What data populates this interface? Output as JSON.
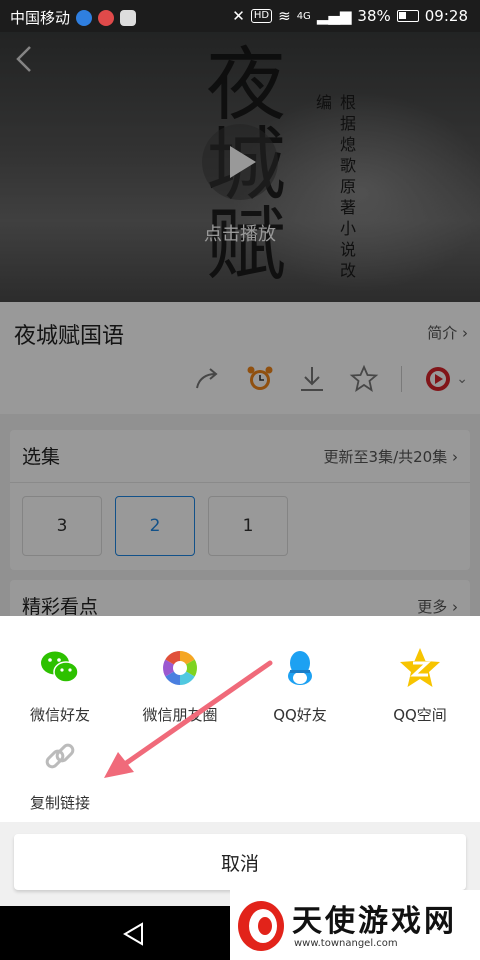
{
  "status_bar": {
    "carrier": "中国移动",
    "battery": "38%",
    "time": "09:28",
    "network": "4G",
    "hd": "HD"
  },
  "video": {
    "play_label": "点击播放",
    "poster_title": "夜城赋",
    "poster_subtitle": "根据熄歌原著小说改编"
  },
  "show": {
    "title": "夜城赋国语",
    "intro_label": "简介"
  },
  "episodes": {
    "title": "选集",
    "update_status": "更新至3集/共20集",
    "items": [
      "3",
      "2",
      "1"
    ]
  },
  "highlights": {
    "title": "精彩看点",
    "more": "更多"
  },
  "share_sheet": {
    "options": [
      {
        "label": "微信好友",
        "icon": "wechat-icon"
      },
      {
        "label": "微信朋友圈",
        "icon": "moments-icon"
      },
      {
        "label": "QQ好友",
        "icon": "qq-icon"
      },
      {
        "label": "QQ空间",
        "icon": "qzone-icon"
      },
      {
        "label": "复制链接",
        "icon": "link-icon"
      }
    ],
    "cancel": "取消"
  },
  "watermark": {
    "text": "天使游戏网",
    "url": "www.townangel.com"
  },
  "colors": {
    "accent": "#1e88e5",
    "wechat": "#2dc100",
    "alarm": "#f08519",
    "qq": "#1da1f2",
    "qzone": "#f7c400",
    "arrow": "#f06a7a"
  }
}
